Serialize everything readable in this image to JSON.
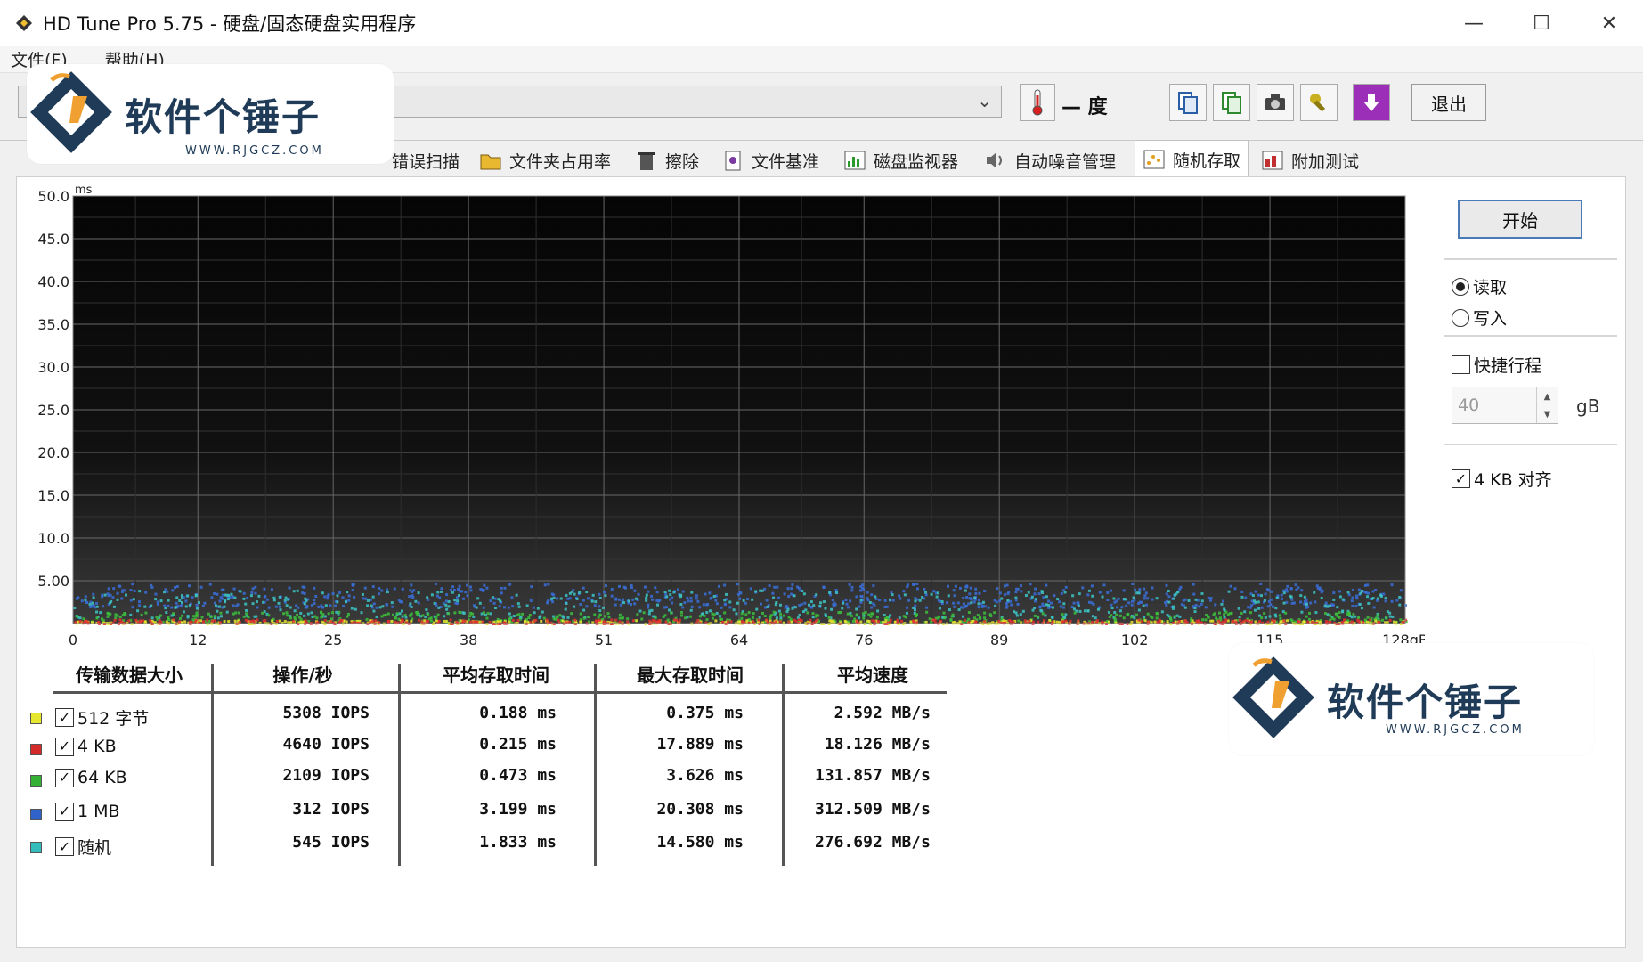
{
  "window": {
    "title": "HD Tune Pro 5.75 - 硬盘/固态硬盘实用程序",
    "minimize": "—",
    "maximize": "☐",
    "close": "✕"
  },
  "menu": [
    "文件(F)",
    "帮助(H)"
  ],
  "toolbar": {
    "temperature": "— 度",
    "exit_label": "退出"
  },
  "tabs": [
    {
      "label": "错误扫描",
      "icon": "error-scan-icon"
    },
    {
      "label": "文件夹占用率",
      "icon": "folder-icon"
    },
    {
      "label": "擦除",
      "icon": "trash-icon"
    },
    {
      "label": "文件基准",
      "icon": "file-benchmark-icon"
    },
    {
      "label": "磁盘监视器",
      "icon": "disk-monitor-icon"
    },
    {
      "label": "自动噪音管理",
      "icon": "speaker-icon"
    },
    {
      "label": "随机存取",
      "icon": "random-access-icon",
      "active": true
    },
    {
      "label": "附加测试",
      "icon": "extra-tests-icon"
    }
  ],
  "side": {
    "start_label": "开始",
    "read_label": "读取",
    "write_label": "写入",
    "mode": "read",
    "short_stroke_label": "快捷行程",
    "short_stroke_checked": false,
    "stroke_value": "40",
    "unit": "gB",
    "align_label": "4 KB 对齐",
    "align_checked": true
  },
  "chart_data": {
    "type": "scatter",
    "yunit": "ms",
    "xunit": "gB",
    "ylim": [
      0,
      50
    ],
    "xlim": [
      0,
      128
    ],
    "yticks": [
      "50.0",
      "45.0",
      "40.0",
      "35.0",
      "30.0",
      "25.0",
      "20.0",
      "15.0",
      "10.0",
      "5.00"
    ],
    "xticks": [
      "0",
      "12",
      "25",
      "38",
      "51",
      "64",
      "76",
      "89",
      "102",
      "115",
      "128gB"
    ],
    "grid": true,
    "background": "#000000",
    "series": [
      {
        "name": "512 字节",
        "color": "#e6e62e",
        "y_range": [
          0.1,
          0.5
        ]
      },
      {
        "name": "4 KB",
        "color": "#e03030",
        "y_range": [
          0.1,
          0.6
        ]
      },
      {
        "name": "64 KB",
        "color": "#3cbf3c",
        "y_range": [
          0.3,
          1.5
        ]
      },
      {
        "name": "1 MB",
        "color": "#3a6fd8",
        "y_range": [
          2.0,
          4.8
        ]
      },
      {
        "name": "随机",
        "color": "#3cc6c6",
        "y_range": [
          0.8,
          4.0
        ]
      }
    ]
  },
  "results": {
    "headers": [
      "传输数据大小",
      "操作/秒",
      "平均存取时间",
      "最大存取时间",
      "平均速度"
    ],
    "rows": [
      {
        "label": "512 字节",
        "color": "#e6e62e",
        "iops": "5308 IOPS",
        "avg": "0.188 ms",
        "max": "0.375 ms",
        "speed": "2.592 MB/s"
      },
      {
        "label": "4 KB",
        "color": "#d42a2a",
        "iops": "4640 IOPS",
        "avg": "0.215 ms",
        "max": "17.889 ms",
        "speed": "18.126 MB/s"
      },
      {
        "label": "64 KB",
        "color": "#34b034",
        "iops": "2109 IOPS",
        "avg": "0.473 ms",
        "max": "3.626 ms",
        "speed": "131.857 MB/s"
      },
      {
        "label": "1 MB",
        "color": "#2f63c9",
        "iops": "312 IOPS",
        "avg": "3.199 ms",
        "max": "20.308 ms",
        "speed": "312.509 MB/s"
      },
      {
        "label": "随机",
        "color": "#34bcbc",
        "iops": "545 IOPS",
        "avg": "1.833 ms",
        "max": "14.580 ms",
        "speed": "276.692 MB/s"
      }
    ]
  },
  "watermark": {
    "text": "软件个锤子",
    "url": "WWW.RJGCZ.COM"
  }
}
